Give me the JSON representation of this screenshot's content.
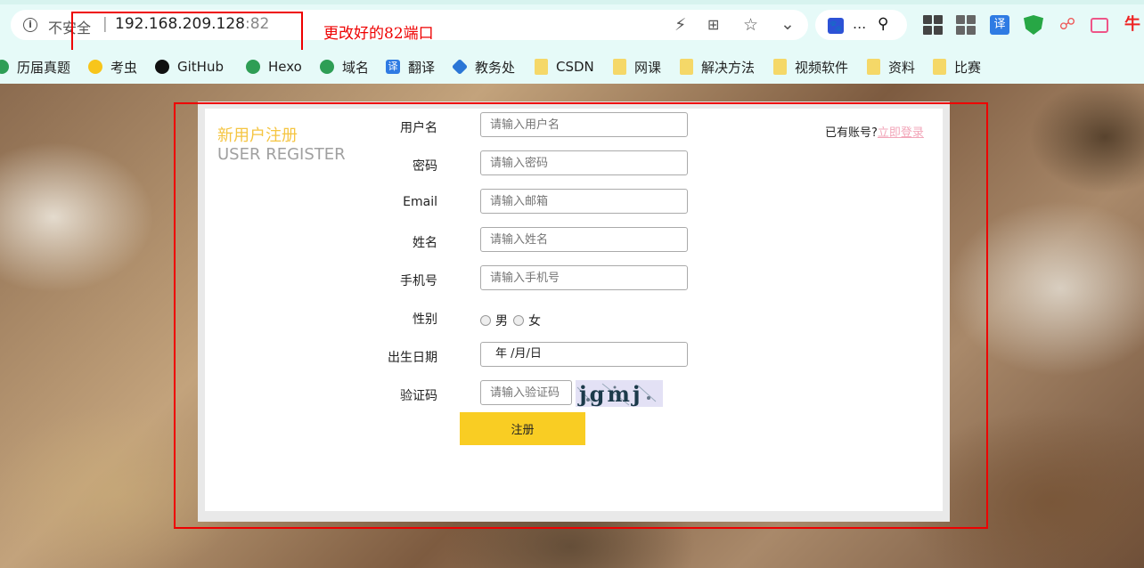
{
  "browser": {
    "insecure_label": "不安全",
    "separator": "|",
    "url_host": "192.168.209.128",
    "url_port": ":82",
    "annotation": "更改好的82端口",
    "search_ellipsis": "...",
    "translate_ext": "译"
  },
  "bookmarks": [
    {
      "label": "历届真题",
      "icon": "globe-icon"
    },
    {
      "label": "考虫",
      "icon": "chick-icon"
    },
    {
      "label": "GitHub",
      "icon": "github-icon"
    },
    {
      "label": "Hexo",
      "icon": "globe-icon"
    },
    {
      "label": "域名",
      "icon": "globe-icon"
    },
    {
      "label": "翻译",
      "icon": "translate-icon"
    },
    {
      "label": "教务处",
      "icon": "jiaowu-icon"
    },
    {
      "label": "CSDN",
      "icon": "folder-icon"
    },
    {
      "label": "网课",
      "icon": "folder-icon"
    },
    {
      "label": "解决方法",
      "icon": "folder-icon"
    },
    {
      "label": "视频软件",
      "icon": "folder-icon"
    },
    {
      "label": "资料",
      "icon": "folder-icon"
    },
    {
      "label": "比赛",
      "icon": "folder-icon"
    }
  ],
  "form": {
    "title_cn": "新用户注册",
    "title_en": "USER REGISTER",
    "has_account": "已有账号?",
    "login_link": "立即登录",
    "fields": {
      "username": {
        "label": "用户名",
        "placeholder": "请输入用户名"
      },
      "password": {
        "label": "密码",
        "placeholder": "请输入密码"
      },
      "email": {
        "label": "Email",
        "placeholder": "请输入邮箱"
      },
      "name": {
        "label": "姓名",
        "placeholder": "请输入姓名"
      },
      "phone": {
        "label": "手机号",
        "placeholder": "请输入手机号"
      },
      "gender": {
        "label": "性别",
        "male": "男",
        "female": "女"
      },
      "birthday": {
        "label": "出生日期",
        "value": "年 /月/日"
      },
      "captcha": {
        "label": "验证码",
        "placeholder": "请输入验证码",
        "image_text": "jgmj"
      }
    },
    "submit_label": "注册"
  }
}
